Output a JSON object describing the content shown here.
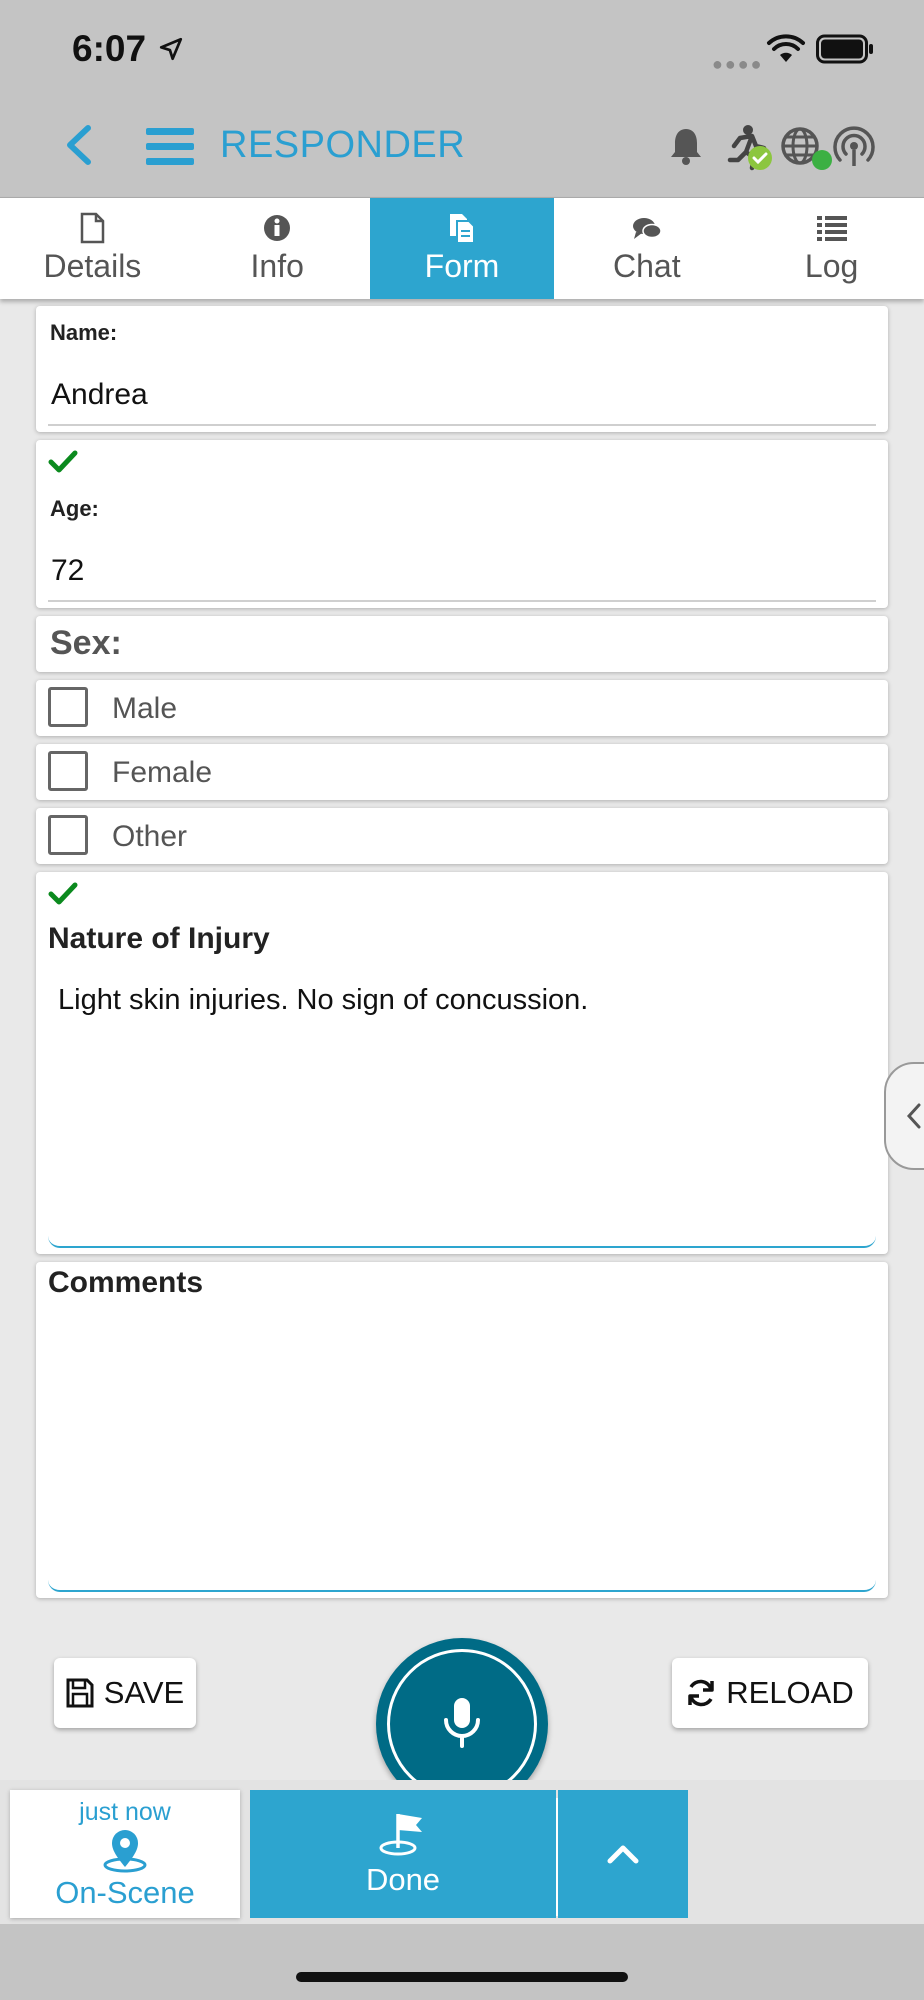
{
  "status_bar": {
    "time": "6:07"
  },
  "header": {
    "title": "RESPONDER"
  },
  "tabs": [
    {
      "label": "Details",
      "icon": "file-icon"
    },
    {
      "label": "Info",
      "icon": "info-icon"
    },
    {
      "label": "Form",
      "icon": "form-icon",
      "active": true
    },
    {
      "label": "Chat",
      "icon": "chat-icon"
    },
    {
      "label": "Log",
      "icon": "list-icon"
    }
  ],
  "form": {
    "name": {
      "label": "Name:",
      "value": "Andrea"
    },
    "age": {
      "label": "Age:",
      "value": "72"
    },
    "sex": {
      "label": "Sex:",
      "options": [
        "Male",
        "Female",
        "Other"
      ]
    },
    "injury": {
      "label": "Nature of Injury",
      "value": "Light skin injuries. No sign of concussion."
    },
    "comments": {
      "label": "Comments",
      "value": ""
    }
  },
  "actions": {
    "save_label": "SAVE",
    "reload_label": "RELOAD"
  },
  "status": {
    "time": "just now",
    "name": "On-Scene",
    "next_label": "Done"
  },
  "colors": {
    "accent": "#2da5cf",
    "header_bg": "#c4c4c4",
    "mic": "#006b86",
    "check": "#0b8a1e"
  }
}
